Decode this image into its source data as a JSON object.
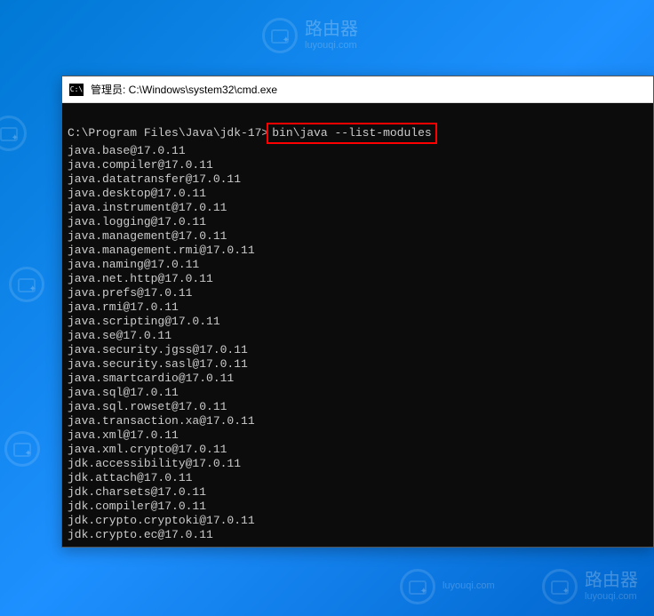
{
  "window": {
    "title": "管理员: C:\\Windows\\system32\\cmd.exe",
    "icon_text": "C:\\"
  },
  "terminal": {
    "prompt_prefix": "C:\\Program Files\\Java\\jdk-17>",
    "command": "bin\\java --list-modules",
    "output": [
      "java.base@17.0.11",
      "java.compiler@17.0.11",
      "java.datatransfer@17.0.11",
      "java.desktop@17.0.11",
      "java.instrument@17.0.11",
      "java.logging@17.0.11",
      "java.management@17.0.11",
      "java.management.rmi@17.0.11",
      "java.naming@17.0.11",
      "java.net.http@17.0.11",
      "java.prefs@17.0.11",
      "java.rmi@17.0.11",
      "java.scripting@17.0.11",
      "java.se@17.0.11",
      "java.security.jgss@17.0.11",
      "java.security.sasl@17.0.11",
      "java.smartcardio@17.0.11",
      "java.sql@17.0.11",
      "java.sql.rowset@17.0.11",
      "java.transaction.xa@17.0.11",
      "java.xml@17.0.11",
      "java.xml.crypto@17.0.11",
      "jdk.accessibility@17.0.11",
      "jdk.attach@17.0.11",
      "jdk.charsets@17.0.11",
      "jdk.compiler@17.0.11",
      "jdk.crypto.cryptoki@17.0.11",
      "jdk.crypto.ec@17.0.11"
    ]
  },
  "watermark": {
    "text_cn": "路由器",
    "text_en": "luyouqi.com"
  }
}
